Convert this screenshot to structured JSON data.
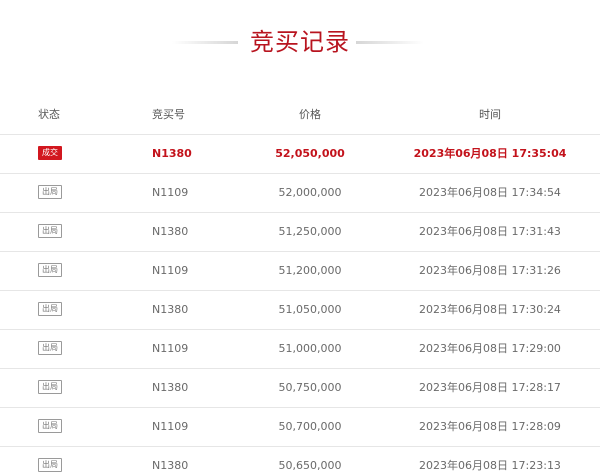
{
  "title": "竞买记录",
  "table": {
    "headers": {
      "status": "状态",
      "bid_no": "竞买号",
      "price": "价格",
      "time": "时间"
    },
    "rows": [
      {
        "status": "成交",
        "bid_no": "N1380",
        "price": "52,050,000",
        "time": "2023年06月08日 17:35:04"
      },
      {
        "status": "出局",
        "bid_no": "N1109",
        "price": "52,000,000",
        "time": "2023年06月08日 17:34:54"
      },
      {
        "status": "出局",
        "bid_no": "N1380",
        "price": "51,250,000",
        "time": "2023年06月08日 17:31:43"
      },
      {
        "status": "出局",
        "bid_no": "N1109",
        "price": "51,200,000",
        "time": "2023年06月08日 17:31:26"
      },
      {
        "status": "出局",
        "bid_no": "N1380",
        "price": "51,050,000",
        "time": "2023年06月08日 17:30:24"
      },
      {
        "status": "出局",
        "bid_no": "N1109",
        "price": "51,000,000",
        "time": "2023年06月08日 17:29:00"
      },
      {
        "status": "出局",
        "bid_no": "N1380",
        "price": "50,750,000",
        "time": "2023年06月08日 17:28:17"
      },
      {
        "status": "出局",
        "bid_no": "N1109",
        "price": "50,700,000",
        "time": "2023年06月08日 17:28:09"
      },
      {
        "status": "出局",
        "bid_no": "N1380",
        "price": "50,650,000",
        "time": "2023年06月08日 17:23:13"
      }
    ]
  },
  "colors": {
    "accent": "#b8141f",
    "win_badge": "#d2171f",
    "text": "#6a6a6a",
    "divider": "#e6e6e6"
  }
}
